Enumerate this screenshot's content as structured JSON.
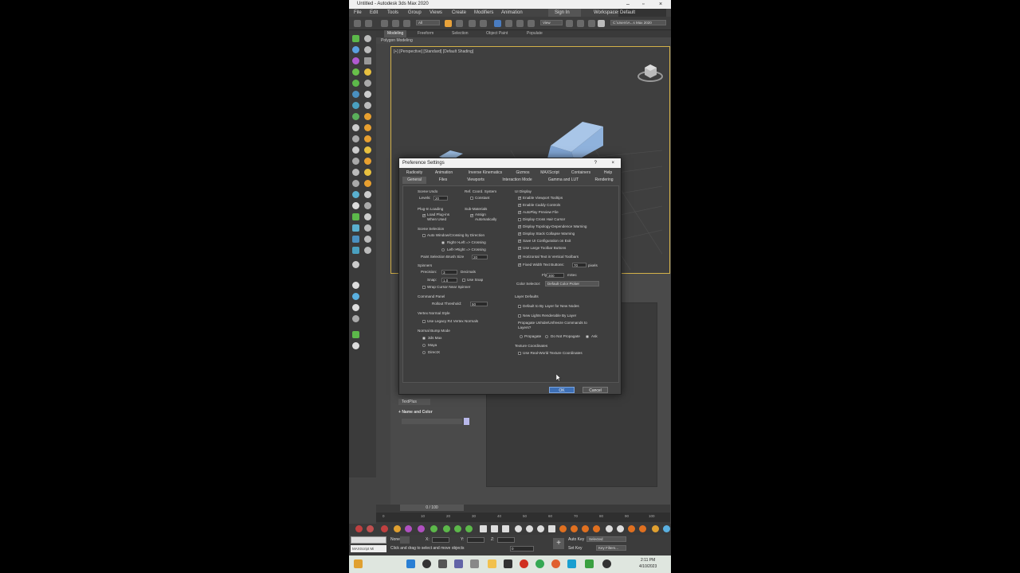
{
  "window": {
    "title": "Untitled - Autodesk 3ds Max 2020",
    "sign_in": "Sign In",
    "workspaces_label": "Workspaces:",
    "workspace_value": "Default",
    "path": "C:\\Users\\A...s Max 2020"
  },
  "menu": [
    "File",
    "Edit",
    "Tools",
    "Group",
    "Views",
    "Create",
    "Modifiers",
    "Animation"
  ],
  "toolbar": {
    "selection_filter": "All",
    "view": "View"
  },
  "ribbon": {
    "tabs": [
      "Modeling",
      "Freeform",
      "Selection",
      "Object Paint",
      "Populate"
    ],
    "sub": "Polygon Modeling"
  },
  "viewport": {
    "label": "[+] [Perspective] [Standard] [Default Shading]"
  },
  "command_panel": {
    "textplus": "TextPlus",
    "name_and_color": "Name and Color"
  },
  "timeline": {
    "frame": "0 / 100",
    "ticks": [
      "0",
      "10",
      "20",
      "30",
      "40",
      "50",
      "60",
      "70",
      "80",
      "90",
      "100"
    ]
  },
  "status": {
    "prompt": "Click and drag to select and move objects",
    "maxscript": "MAXScript Mi",
    "none": "None",
    "x_label": "X:",
    "y_label": "Y:",
    "z_label": "Z:",
    "auto_key": "Auto Key",
    "set_key": "Set Key",
    "selected": "Selected",
    "key_filters": "Key Filters...",
    "frame_field": "0"
  },
  "taskbar": {
    "time": "2:11 PM",
    "date": "4/10/2023"
  },
  "dialog": {
    "title": "Preference Settings",
    "help": "?",
    "close": "×",
    "tabs_row1": [
      "Radiosity",
      "Animation",
      "Inverse Kinematics",
      "Gizmos",
      "MAXScript",
      "Containers",
      "Help"
    ],
    "tabs_row2": [
      "General",
      "Files",
      "Viewports",
      "Interaction Mode",
      "Gamma and LUT",
      "Rendering"
    ],
    "scene_undo": {
      "title": "Scene Undo",
      "levels_label": "Levels:",
      "levels": "20"
    },
    "ref_coord": {
      "title": "Ref. Coord. System",
      "constant": "Constant"
    },
    "plugin_loading": {
      "title": "Plug-In Loading",
      "load": "Load Plug-ins When Used"
    },
    "sub_materials": {
      "title": "Sub-Materials",
      "assign": "Assign Automatically"
    },
    "scene_selection": {
      "title": "Scene Selection",
      "auto_window": "Auto Window/Crossing by Direction",
      "right_left": "Right->Left => Crossing",
      "left_right": "Left->Right => Crossing",
      "brush_size_label": "Paint Selection Brush Size",
      "brush_size": "20"
    },
    "spinners": {
      "title": "Spinners",
      "precision_label": "Precision:",
      "precision": "3",
      "decimals": "Decimals",
      "snap_label": "Snap:",
      "snap": "1.0",
      "use_snap": "Use Snap",
      "wrap_cursor": "Wrap Cursor Near Spinner"
    },
    "command_panel": {
      "title": "Command Panel",
      "rollout_label": "Rollout Threshold:",
      "rollout": "50"
    },
    "vertex_normal": {
      "title": "Vertex Normal Style",
      "legacy": "Use Legacy R4 Vertex Normals"
    },
    "normal_bump": {
      "title": "Normal Bump Mode",
      "options": [
        "3ds Max",
        "Maya",
        "DirectX"
      ]
    },
    "ui_display": {
      "title": "UI Display",
      "items": [
        "Enable Viewport Tooltips",
        "Enable Caddy Controls",
        "AutoPlay Preview File",
        "Display Cross Hair Cursor",
        "Display Topology-Dependence Warning",
        "Display Stack Collapse Warning",
        "Save UI Configuration on Exit",
        "Use Large Toolbar Buttons",
        "Horizontal Text in Vertical Toolbars",
        "Fixed Width Text Buttons:"
      ],
      "fixed_width": "70",
      "pixels": "pixels",
      "flyout_label": "Flyout Time:",
      "flyout": "300",
      "msec": "mSec",
      "color_selector_label": "Color Selector:",
      "color_selector": "Default Color Picker"
    },
    "layer_defaults": {
      "title": "Layer Defaults",
      "by_layer": "Default to By Layer for New Nodes",
      "new_lights": "New Lights Renderable By Layer",
      "propagate_q": "Propagate Unhide/Unfreeze Commands to Layers?",
      "propagate": "Propagate",
      "do_not": "Do Not Propagate",
      "ask": "Ask"
    },
    "texture_coords": {
      "title": "Texture Coordinates",
      "real_world": "Use Real-World Texture Coordinates"
    },
    "ok": "OK",
    "cancel": "Cancel"
  }
}
